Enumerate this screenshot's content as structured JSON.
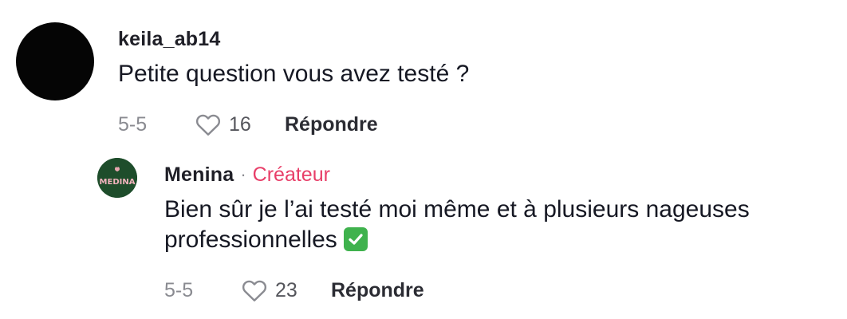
{
  "comments": [
    {
      "username": "keila_ab14",
      "text": "Petite question vous avez testé ?",
      "date": "5-5",
      "likes": "16",
      "reply_label": "Répondre"
    }
  ],
  "reply": {
    "username": "Menina",
    "separator": "·",
    "badge": "Créateur",
    "avatar_text": "MEDINA",
    "text_line1": "Bien sûr je l’ai testé moi même et à plusieurs nageuses",
    "text_line2": "professionnelles",
    "emoji": "check-mark-button-icon",
    "date": "5-5",
    "likes": "23",
    "reply_label": "Répondre"
  },
  "colors": {
    "creator_badge": "#e83e68",
    "muted": "#8a8b91",
    "avatar_menina_bg": "#1e4d2b",
    "emoji_green": "#3fb24d"
  }
}
